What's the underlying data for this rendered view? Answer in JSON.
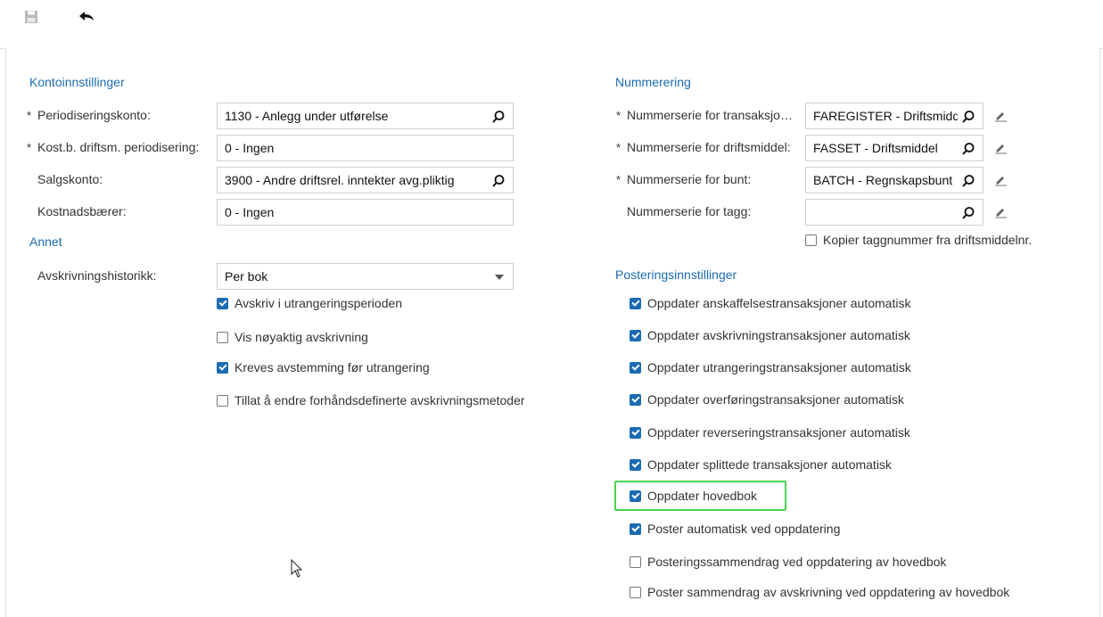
{
  "toolbar": {
    "save_icon": "save-icon",
    "undo_icon": "undo-icon"
  },
  "left": {
    "konto_title": "Kontoinnstillinger",
    "fields": [
      {
        "label": "Periodiseringskonto:",
        "required": "*",
        "value": "1130 - Anlegg under utførelse"
      },
      {
        "label": "Kost.b. driftsm. periodisering:",
        "required": "*",
        "value": "0 - Ingen"
      },
      {
        "label": "Salgskonto:",
        "required": "",
        "value": "3900 - Andre driftsrel. inntekter avg.pliktig"
      },
      {
        "label": "Kostnadsbærer:",
        "required": "",
        "value": "0 - Ingen"
      }
    ],
    "annet_title": "Annet",
    "avskrivning_label": "Avskrivningshistorikk:",
    "avskrivning_value": "Per bok",
    "checks": [
      {
        "label": "Avskriv i utrangeringsperioden",
        "checked": true
      },
      {
        "label": "Vis nøyaktig avskrivning",
        "checked": false
      },
      {
        "label": "Kreves avstemming før utrangering",
        "checked": true
      },
      {
        "label": "Tillat å endre forhåndsdefinerte avskrivningsmetoder",
        "checked": false
      }
    ]
  },
  "right": {
    "num_title": "Nummerering",
    "fields": [
      {
        "label": "Nummerserie for transaksjoner:",
        "required": "*",
        "value": "FAREGISTER - Driftsmiddelregister"
      },
      {
        "label": "Nummerserie for driftsmiddel:",
        "required": "*",
        "value": "FASSET - Driftsmiddel"
      },
      {
        "label": "Nummerserie for bunt:",
        "required": "*",
        "value": "BATCH - Regnskapsbunt"
      },
      {
        "label": "Nummerserie for tagg:",
        "required": "",
        "value": ""
      }
    ],
    "copy_tag": {
      "label": "Kopier taggnummer fra driftsmiddelnr.",
      "checked": false
    },
    "post_title": "Posteringsinnstillinger",
    "checks": [
      {
        "label": "Oppdater anskaffelsestransaksjoner automatisk",
        "checked": true
      },
      {
        "label": "Oppdater avskrivningstransaksjoner automatisk",
        "checked": true
      },
      {
        "label": "Oppdater utrangeringstransaksjoner automatisk",
        "checked": true
      },
      {
        "label": "Oppdater overføringstransaksjoner automatisk",
        "checked": true
      },
      {
        "label": "Oppdater reverseringstransaksjoner automatisk",
        "checked": true
      },
      {
        "label": "Oppdater splittede transaksjoner automatisk",
        "checked": true
      },
      {
        "label": "Oppdater hovedbok",
        "checked": true
      },
      {
        "label": "Poster automatisk ved oppdatering",
        "checked": true
      },
      {
        "label": "Posteringssammendrag ved oppdatering av hovedbok",
        "checked": false
      },
      {
        "label": "Poster sammendrag av avskrivning ved oppdatering av hovedbok",
        "checked": false
      }
    ]
  },
  "colors": {
    "accent": "#1a6bb3",
    "highlight": "#4cd24c"
  }
}
